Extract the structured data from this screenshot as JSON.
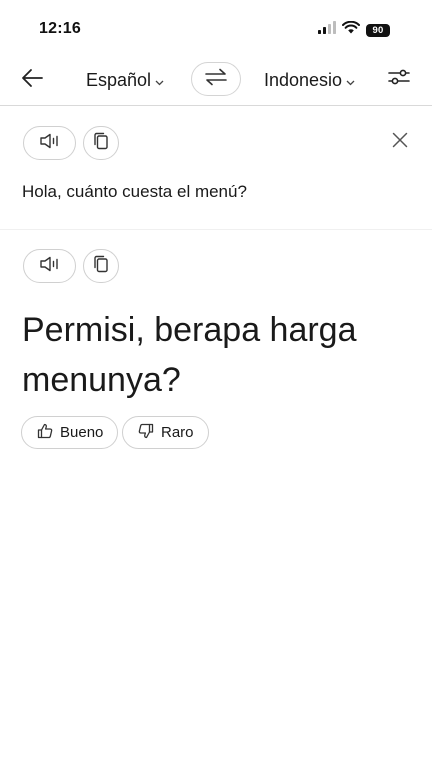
{
  "status_bar": {
    "time": "12:16",
    "battery": "90",
    "icons": [
      "cellular-signal-icon",
      "wifi-icon",
      "battery-icon"
    ]
  },
  "header": {
    "back_icon": "arrow-left-icon",
    "source_language": "Español",
    "target_language": "Indonesio",
    "swap_icon": "swap-arrows-icon",
    "settings_icon": "sliders-icon"
  },
  "source": {
    "text": "Hola, cuánto cuesta el menú?",
    "speak_icon": "speaker-icon",
    "copy_icon": "copy-icon",
    "close_icon": "close-icon"
  },
  "translation": {
    "text": "Permisi, berapa harga menunya?",
    "speak_icon": "speaker-icon",
    "copy_icon": "copy-icon"
  },
  "feedback": {
    "good_label": "Bueno",
    "bad_label": "Raro",
    "good_icon": "thumbs-up-icon",
    "bad_icon": "thumbs-down-icon"
  },
  "colors": {
    "background": "#ffffff",
    "text": "#1a1a1a",
    "border": "#d0d0d0",
    "divider": "#d9d9d9"
  }
}
